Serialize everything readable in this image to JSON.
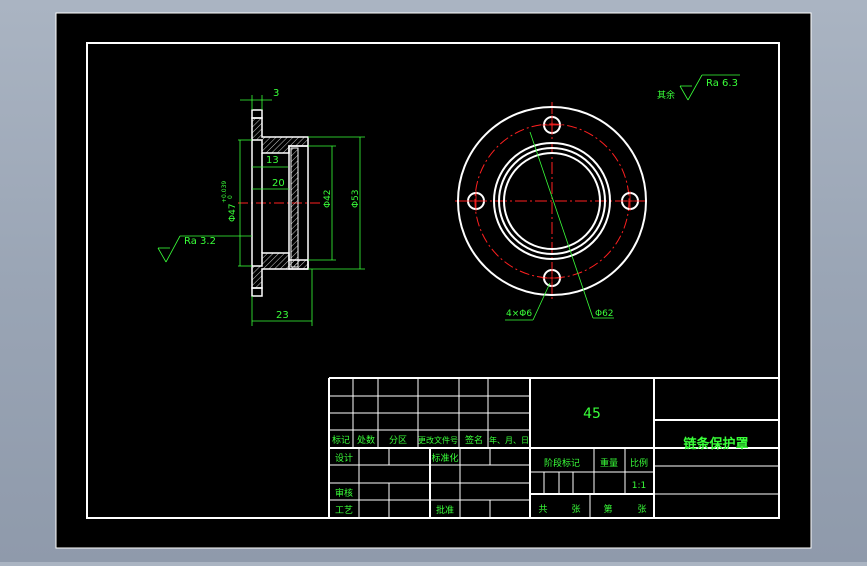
{
  "colors": {
    "background_outer": "#9aa5b5",
    "sheet": "#000000",
    "outline": "#ffffff",
    "dimension": "#39ff39",
    "centerline": "#ff2020",
    "hidden": "#ffff00"
  },
  "side_view": {
    "dim_top": "3",
    "dim_inner_step": "13",
    "dim_inner_depth": "20",
    "dim_bore": "Φ47",
    "dim_bore_tol_upper": "+0.039",
    "dim_bore_tol_lower": "0",
    "dim_mid": "Φ42",
    "dim_outer": "Φ53",
    "dim_length": "23",
    "roughness_label": "Ra 3.2"
  },
  "front_view": {
    "holes_label": "4×Φ6",
    "pcd_label": "Φ62"
  },
  "roughness_note": {
    "prefix": "其余",
    "value": "Ra 6.3"
  },
  "title_block": {
    "material": "45",
    "part_name": "链条保护罩",
    "revision_headers": [
      "标记",
      "处数",
      "分区",
      "更改文件号",
      "签名",
      "年、月、日"
    ],
    "row_design": "设计",
    "row_standardize": "标准化",
    "row_review": "审核",
    "row_process": "工艺",
    "row_approve": "批准",
    "stage_mark": "阶段标记",
    "weight": "重量",
    "scale": "比例",
    "scale_value": "1:1",
    "sheets_total": "共",
    "sheets_unit": "张",
    "sheet_no": "第",
    "sheet_no_unit": "张"
  }
}
